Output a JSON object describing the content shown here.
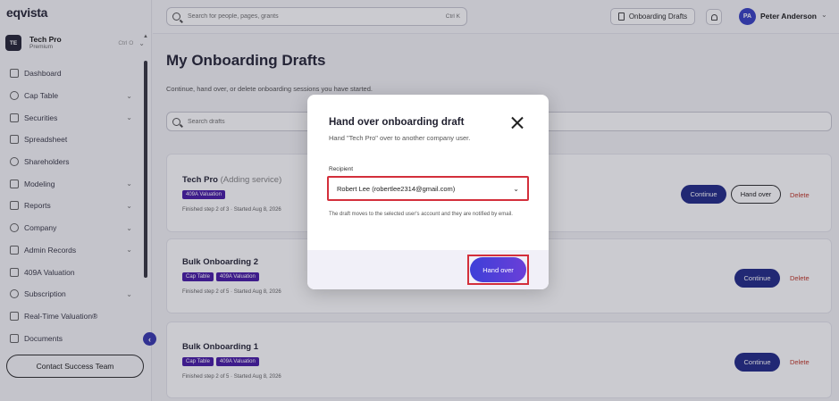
{
  "app": {
    "logo": "eqvista"
  },
  "company": {
    "avatar": "TE",
    "name": "Tech Pro",
    "plan": "Premium",
    "shortcut": "Ctrl O"
  },
  "sidebar": {
    "items": [
      {
        "label": "Dashboard",
        "icon": "dashboard-icon",
        "has_chevron": false
      },
      {
        "label": "Cap Table",
        "icon": "pie-chart-icon",
        "has_chevron": true
      },
      {
        "label": "Securities",
        "icon": "securities-icon",
        "has_chevron": true
      },
      {
        "label": "Spreadsheet",
        "icon": "spreadsheet-icon",
        "has_chevron": false
      },
      {
        "label": "Shareholders",
        "icon": "users-icon",
        "has_chevron": false
      },
      {
        "label": "Modeling",
        "icon": "modeling-icon",
        "has_chevron": true
      },
      {
        "label": "Reports",
        "icon": "reports-icon",
        "has_chevron": true
      },
      {
        "label": "Company",
        "icon": "company-icon",
        "has_chevron": true
      },
      {
        "label": "Admin Records",
        "icon": "records-icon",
        "has_chevron": true
      },
      {
        "label": "409A Valuation",
        "icon": "shield-icon",
        "has_chevron": false
      },
      {
        "label": "Subscription",
        "icon": "subscription-icon",
        "has_chevron": true
      },
      {
        "label": "Real-Time Valuation®",
        "icon": "trend-icon",
        "has_chevron": false
      },
      {
        "label": "Documents",
        "icon": "documents-icon",
        "has_chevron": false
      }
    ],
    "contact_label": "Contact Success Team"
  },
  "topbar": {
    "search_placeholder": "Search for people, pages, grants",
    "search_shortcut": "Ctrl K",
    "drafts_label": "Onboarding Drafts",
    "user_initials": "PA",
    "user_name": "Peter Anderson"
  },
  "main": {
    "title": "My Onboarding Drafts",
    "subtitle": "Continue, hand over, or delete onboarding sessions you have started.",
    "search_placeholder": "Search drafts",
    "continue_label": "Continue",
    "handover_label": "Hand over",
    "delete_label": "Delete",
    "drafts": [
      {
        "title": "Tech Pro",
        "service": "(Adding service)",
        "tags": [
          "409A Valuation"
        ],
        "meta": "Finished step 2 of 3 · Started Aug 8, 2026"
      },
      {
        "title": "Bulk Onboarding 2",
        "service": "",
        "tags": [
          "Cap Table",
          "409A Valuation"
        ],
        "meta": "Finished step 2 of 5 · Started Aug 8, 2026"
      },
      {
        "title": "Bulk Onboarding 1",
        "service": "",
        "tags": [
          "Cap Table",
          "409A Valuation"
        ],
        "meta": "Finished step 2 of 5 · Started Aug 8, 2026"
      }
    ]
  },
  "modal": {
    "title": "Hand over onboarding draft",
    "subtitle": "Hand \"Tech Pro\" over to another company user.",
    "recipient_label": "Recipient",
    "recipient_value": "Robert Lee (robertlee2314@gmail.com)",
    "helper": "The draft moves to the selected user's account and they are notified by email.",
    "submit_label": "Hand over"
  },
  "colors": {
    "accent": "#3b45c4",
    "tag": "#4b1fa7",
    "continue": "#262f8a",
    "delete": "#c0392b",
    "highlight": "#d32f3b"
  }
}
